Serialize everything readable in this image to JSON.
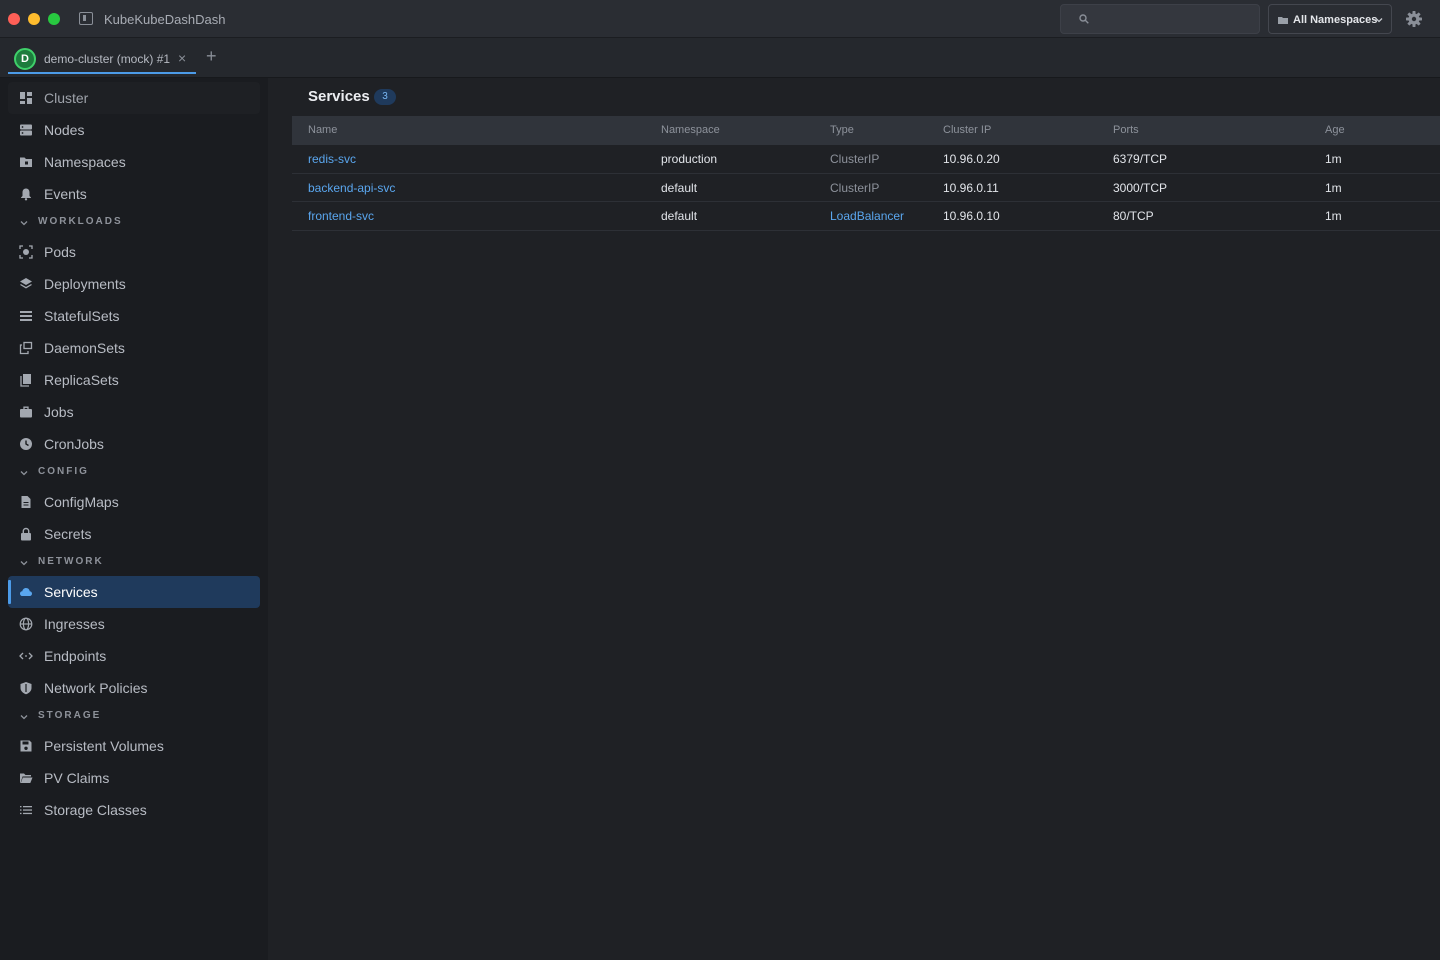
{
  "app": {
    "title": "KubeKubeDashDash"
  },
  "header": {
    "search_placeholder": "",
    "namespace_label": "All Namespaces"
  },
  "tabs": [
    {
      "avatar": "D",
      "label": "demo-cluster (mock) #1",
      "close": "×"
    }
  ],
  "tab_add": "+",
  "sidebar": {
    "top_items": [
      {
        "label": "Cluster",
        "icon": "dashboard-icon"
      },
      {
        "label": "Nodes",
        "icon": "server-icon"
      },
      {
        "label": "Namespaces",
        "icon": "folder-icon"
      },
      {
        "label": "Events",
        "icon": "bell-icon"
      }
    ],
    "sections": {
      "workloads": {
        "label": "WORKLOADS",
        "items": [
          {
            "label": "Pods",
            "icon": "pod-icon"
          },
          {
            "label": "Deployments",
            "icon": "layers-icon"
          },
          {
            "label": "StatefulSets",
            "icon": "list-icon"
          },
          {
            "label": "DaemonSets",
            "icon": "copy-icon"
          },
          {
            "label": "ReplicaSets",
            "icon": "replica-icon"
          },
          {
            "label": "Jobs",
            "icon": "briefcase-icon"
          },
          {
            "label": "CronJobs",
            "icon": "clock-icon"
          }
        ]
      },
      "config": {
        "label": "CONFIG",
        "items": [
          {
            "label": "ConfigMaps",
            "icon": "file-icon"
          },
          {
            "label": "Secrets",
            "icon": "lock-icon"
          }
        ]
      },
      "network": {
        "label": "NETWORK",
        "items": [
          {
            "label": "Services",
            "icon": "cloud-icon"
          },
          {
            "label": "Ingresses",
            "icon": "globe-icon"
          },
          {
            "label": "Endpoints",
            "icon": "code-icon"
          },
          {
            "label": "Network Policies",
            "icon": "shield-icon"
          }
        ]
      },
      "storage": {
        "label": "STORAGE",
        "items": [
          {
            "label": "Persistent Volumes",
            "icon": "disk-icon"
          },
          {
            "label": "PV Claims",
            "icon": "folder-open-icon"
          },
          {
            "label": "Storage Classes",
            "icon": "lines-icon"
          }
        ]
      }
    },
    "active": "Services"
  },
  "main": {
    "title": "Services",
    "count": "3",
    "columns": [
      "Name",
      "Namespace",
      "Type",
      "Cluster IP",
      "Ports",
      "Age"
    ],
    "rows": [
      [
        "redis-svc",
        "production",
        "ClusterIP",
        "10.96.0.20",
        "6379/TCP",
        "1m"
      ],
      [
        "backend-api-svc",
        "default",
        "ClusterIP",
        "10.96.0.11",
        "3000/TCP",
        "1m"
      ],
      [
        "frontend-svc",
        "default",
        "LoadBalancer",
        "10.96.0.10",
        "80/TCP",
        "1m"
      ]
    ]
  },
  "colors": {
    "accent": "#4c9be8",
    "active_bg": "#1f3a5c",
    "link": "#5aa6ee",
    "cluster_ring": "#3fd06a"
  }
}
